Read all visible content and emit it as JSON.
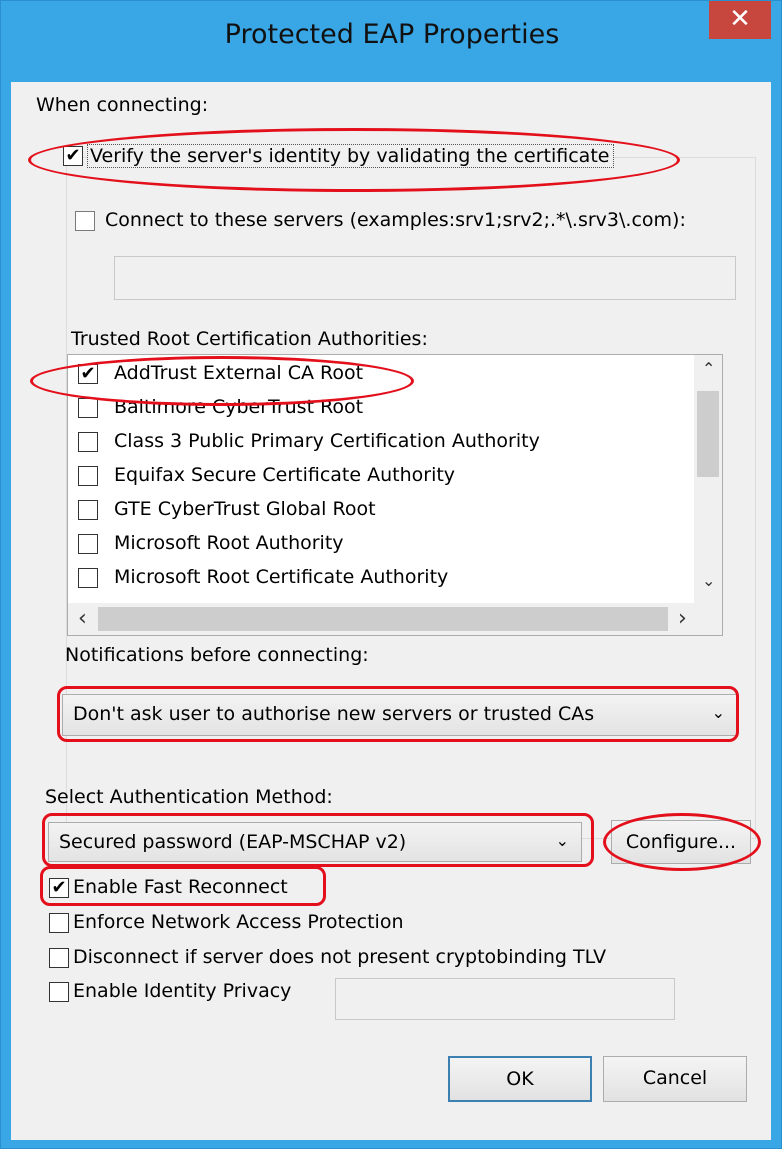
{
  "window": {
    "title": "Protected EAP Properties",
    "close_glyph": "✕"
  },
  "labels": {
    "when_connecting": "When connecting:",
    "verify_identity": "Verify the server's identity by validating the certificate",
    "connect_servers": "Connect to these servers (examples:srv1;srv2;.*\\.srv3\\.com):",
    "trusted_root": "Trusted Root Certification Authorities:",
    "notifications": "Notifications before connecting:",
    "select_auth": "Select Authentication Method:"
  },
  "servers_field": {
    "value": ""
  },
  "checkbox_glyph": "✔",
  "certificates": [
    {
      "label": "AddTrust External CA Root",
      "checked": true
    },
    {
      "label": "Baltimore CyberTrust Root",
      "checked": false
    },
    {
      "label": "Class 3 Public Primary Certification Authority",
      "checked": false
    },
    {
      "label": "Equifax Secure Certificate Authority",
      "checked": false
    },
    {
      "label": "GTE CyberTrust Global Root",
      "checked": false
    },
    {
      "label": "Microsoft Root Authority",
      "checked": false
    },
    {
      "label": "Microsoft Root Certificate Authority",
      "checked": false
    }
  ],
  "notifications_select": {
    "value": "Don't ask user to authorise new servers or trusted CAs"
  },
  "auth_method_select": {
    "value": "Secured password (EAP-MSCHAP v2)"
  },
  "configure_button": "Configure...",
  "options": [
    {
      "label": "Enable Fast Reconnect",
      "checked": true
    },
    {
      "label": "Enforce Network Access Protection",
      "checked": false
    },
    {
      "label": "Disconnect if server does not present cryptobinding TLV",
      "checked": false
    },
    {
      "label": "Enable Identity Privacy",
      "checked": false
    }
  ],
  "identity_field": {
    "value": ""
  },
  "buttons": {
    "ok": "OK",
    "cancel": "Cancel"
  },
  "icons": {
    "chevron_down": "⌄",
    "scroll_up": "⌃",
    "scroll_down": "⌄",
    "scroll_left": "‹",
    "scroll_right": "›"
  },
  "colors": {
    "titlebar": "#39a7e6",
    "close": "#c7463d",
    "annotation": "#e3101c"
  }
}
